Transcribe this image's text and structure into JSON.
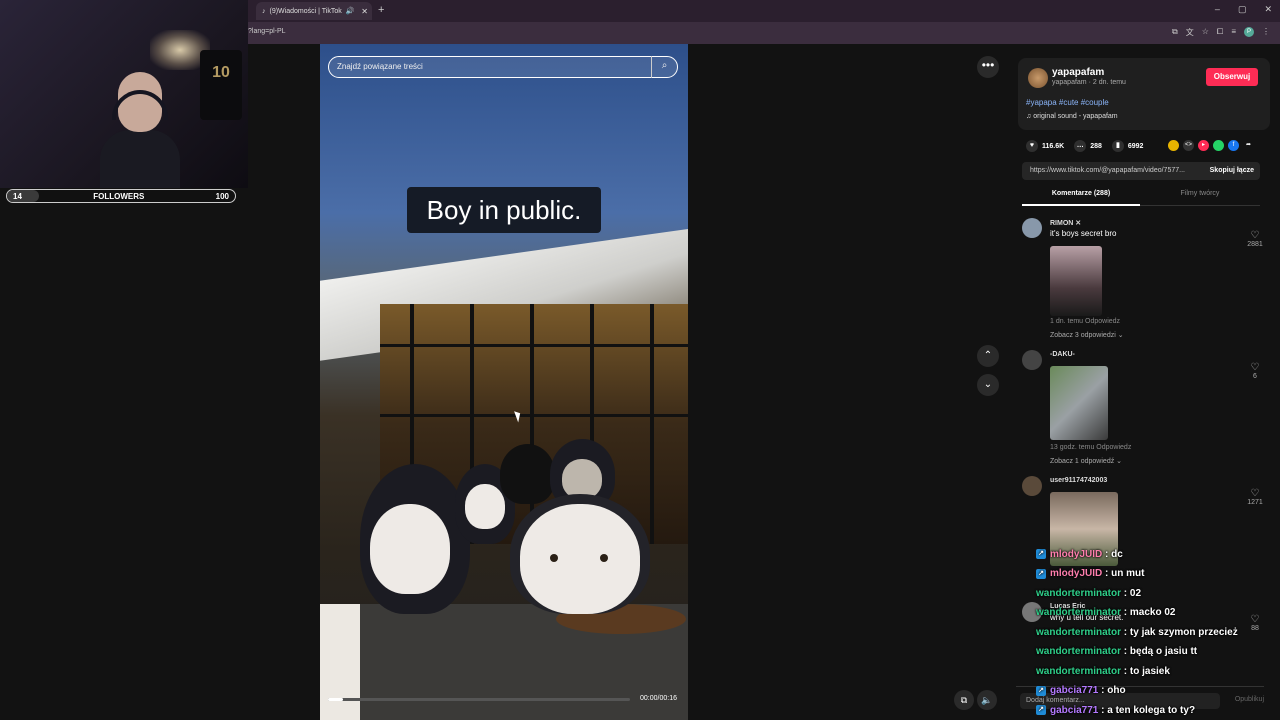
{
  "browser": {
    "tab_title": "(9)Wiadomości | TikTok",
    "new_tab": "+",
    "url": "?lang=pl-PL",
    "window_controls": [
      "–",
      "▢",
      "✕"
    ]
  },
  "stream_overlay": {
    "followers_label": "FOLLOWERS",
    "followers_current": "14",
    "followers_goal": "100",
    "followers_progress": 0.14,
    "jersey_number": "10"
  },
  "video": {
    "search_placeholder": "Znajdź powiązane treści",
    "caption": "Boy in public.",
    "time": "00:00/00:16",
    "progress": 0.05
  },
  "side_controls": {
    "more": "•••",
    "up": "⌃",
    "down": "⌄"
  },
  "post": {
    "username": "yapapafam",
    "subline": "yapapafam · 2 dn. temu",
    "follow_label": "Obserwuj",
    "hashtags": "#yapapa #cute #couple",
    "sound": "♫  original sound - yapapafam",
    "likes": "116.6K",
    "comments": "288",
    "saves": "6992",
    "link": "https://www.tiktok.com/@yapapafam/video/7577...",
    "copy_link": "Skopiuj łącze",
    "tab_comments": "Komentarze (288)",
    "tab_creator_videos": "Filmy twórcy"
  },
  "comments": [
    {
      "name": "RIMON ✕",
      "text": "it's boys secret bro",
      "meta": "1 dn. temu     Odpowiedz",
      "more": "Zobacz 3 odpowiedzi ⌄",
      "likes": "2881"
    },
    {
      "name": "-DAKU-",
      "text": "",
      "meta": "13 godz. temu     Odpowiedz",
      "more": "Zobacz 1 odpowiedź ⌄",
      "likes": "6"
    },
    {
      "name": "user91174742003",
      "text": "",
      "meta": "",
      "more": "",
      "likes": "1271"
    },
    {
      "name": "Lucas Eric",
      "text": "why u tell our secret.",
      "meta": "",
      "more": "",
      "likes": "88"
    }
  ],
  "add_comment": {
    "placeholder": "Dodaj komentarz...",
    "publish": "Opublikuj"
  },
  "chat": [
    {
      "user": "mlodyJUID",
      "msg": ": dc",
      "color": "#ff7fae",
      "icon": true
    },
    {
      "user": "mlodyJUID",
      "msg": ": un mut",
      "color": "#ff7fae",
      "icon": true
    },
    {
      "user": "wandorterminator",
      "msg": ": 02",
      "color": "#2fcf8a",
      "icon": false
    },
    {
      "user": "wandorterminator",
      "msg": ": macko 02",
      "color": "#2fcf8a",
      "icon": false
    },
    {
      "user": "wandorterminator",
      "msg": ": ty jak szymon przecież",
      "color": "#2fcf8a",
      "icon": false
    },
    {
      "user": "wandorterminator",
      "msg": ": będą o jasiu tt",
      "color": "#2fcf8a",
      "icon": false
    },
    {
      "user": "wandorterminator",
      "msg": ": to jasiek",
      "color": "#2fcf8a",
      "icon": false
    },
    {
      "user": "gabcia771",
      "msg": ": oho",
      "color": "#b47aff",
      "icon": true
    },
    {
      "user": "gabcia771",
      "msg": ": a ten kolega to ty?",
      "color": "#b47aff",
      "icon": true
    }
  ]
}
